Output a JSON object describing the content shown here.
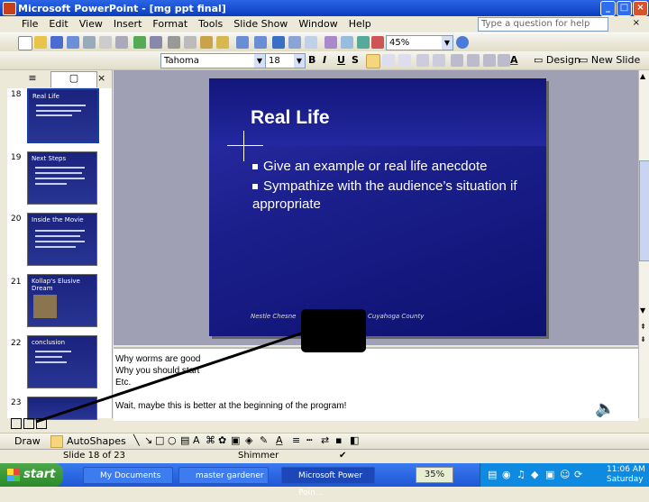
{
  "window": {
    "title": "Microsoft PowerPoint - [mg ppt final]"
  },
  "menu": {
    "items": [
      "File",
      "Edit",
      "View",
      "Insert",
      "Format",
      "Tools",
      "Slide Show",
      "Window",
      "Help"
    ],
    "ask_placeholder": "Type a question for help"
  },
  "standard_toolbar": {
    "zoom": "45%"
  },
  "format_toolbar": {
    "font": "Tahoma",
    "size": "18",
    "design_label": "Design",
    "new_slide_label": "New Slide"
  },
  "thumbnails": [
    {
      "num": "18",
      "title": "Real Life"
    },
    {
      "num": "19",
      "title": "Next Steps"
    },
    {
      "num": "20",
      "title": "Inside the Movie"
    },
    {
      "num": "21",
      "title": "Kollap's Elusive Dream"
    },
    {
      "num": "22",
      "title": "conclusion"
    },
    {
      "num": "23",
      "title": ""
    }
  ],
  "slide": {
    "title": "Real Life",
    "bullets": [
      "Give an example or real life anecdote",
      "Sympathize with the audience’s situation if appropriate"
    ],
    "footer_left": "Nestle Chesne",
    "footer_right": "Cuyahoga County"
  },
  "notes": {
    "lines": [
      "Why worms are good",
      "Why you should start",
      "Etc.",
      "Wait, maybe this is better at the beginning of the program!"
    ]
  },
  "drawing_toolbar": {
    "draw_label": "Draw",
    "autoshapes_label": "AutoShapes"
  },
  "status": {
    "slide_info": "Slide 18 of 23",
    "design": "Shimmer"
  },
  "taskbar": {
    "start": "start",
    "tasks": [
      "My Documents",
      "master gardener",
      "Microsoft Power Poin..."
    ],
    "zoom_badge": "35%",
    "clock": "11:06 AM",
    "day": "Saturday"
  },
  "colors": {
    "slide_bg": "#1a1e8a",
    "title_bar": "#0a3dbd",
    "taskbar": "#1f56d6"
  }
}
